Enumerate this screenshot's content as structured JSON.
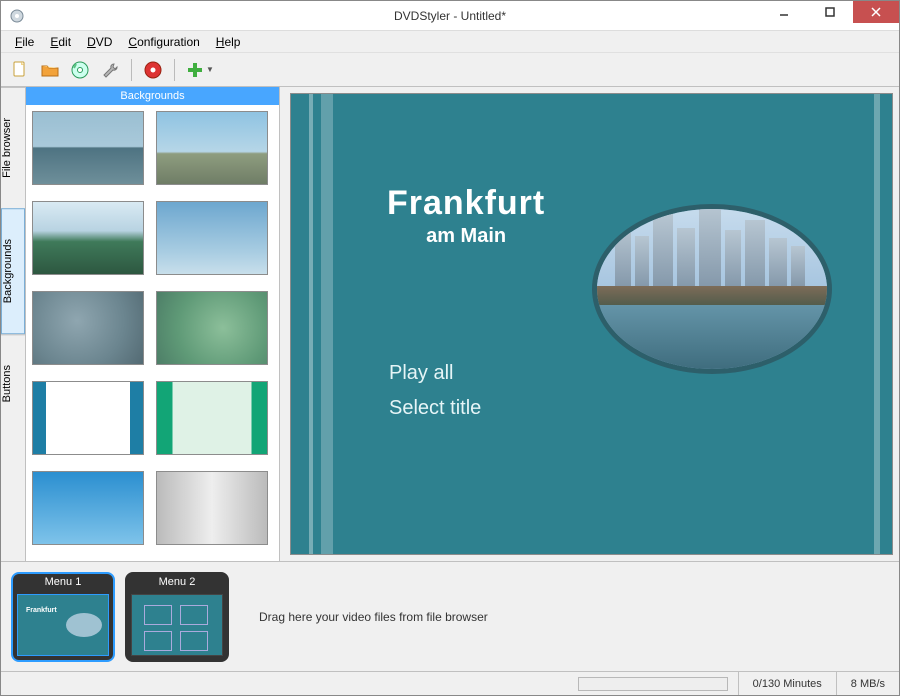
{
  "window": {
    "title": "DVDStyler - Untitled*"
  },
  "menu": {
    "file": "File",
    "edit": "Edit",
    "dvd": "DVD",
    "config": "Configuration",
    "help": "Help"
  },
  "toolbar_icons": {
    "new": "new-file-icon",
    "open": "open-folder-icon",
    "save": "save-disc-icon",
    "settings": "settings-wrench-icon",
    "burn": "burn-disc-icon",
    "add": "add-plus-icon"
  },
  "side_tabs": {
    "file_browser": "File browser",
    "backgrounds": "Backgrounds",
    "buttons": "Buttons"
  },
  "panel": {
    "header": "Backgrounds"
  },
  "backgrounds": [
    {
      "name": "sea-horizon"
    },
    {
      "name": "sea-ship"
    },
    {
      "name": "coast-green"
    },
    {
      "name": "sky-haze"
    },
    {
      "name": "blur-grey"
    },
    {
      "name": "blur-green"
    },
    {
      "name": "stripe-blue"
    },
    {
      "name": "stripe-green"
    },
    {
      "name": "gradient-blue"
    },
    {
      "name": "gradient-silver"
    }
  ],
  "preview": {
    "title_line1": "Frankfurt",
    "title_line2": "am Main",
    "option_play": "Play all",
    "option_select": "Select title"
  },
  "timeline": {
    "menu1": "Menu 1",
    "menu2": "Menu 2",
    "hint": "Drag here your video files from file browser"
  },
  "status": {
    "minutes": "0/130 Minutes",
    "bitrate": "8 MB/s"
  }
}
